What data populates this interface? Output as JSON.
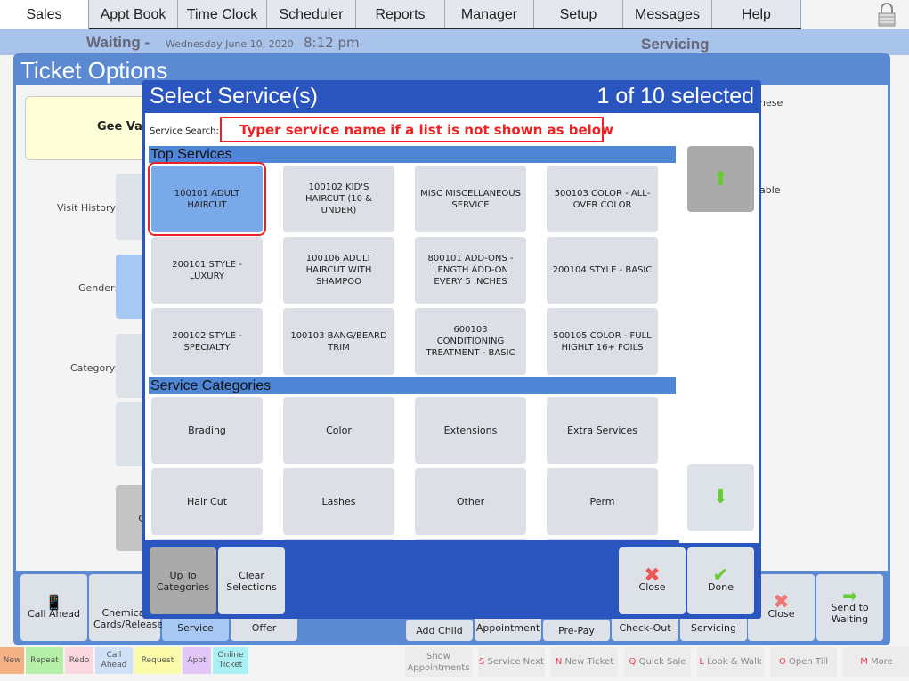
{
  "nav": {
    "tabs": [
      "Sales",
      "Appt Book",
      "Time Clock",
      "Scheduler",
      "Reports",
      "Manager",
      "Setup",
      "Messages",
      "Help"
    ],
    "active": "Sales"
  },
  "header": {
    "waiting": "Waiting -",
    "date": "Wednesday June 10, 2020",
    "time": "8:12 pm",
    "servicing": "Servicing"
  },
  "ticket": {
    "title": "Ticket Options",
    "client": "Gee Var",
    "visit_history": "Visit History:",
    "gender": "Gender:",
    "category": "Category:",
    "right_text_1": "nese",
    "right_text_2": "able",
    "partial_btn": "Cu"
  },
  "toolbar": {
    "call_ahead": "Call Ahead",
    "chemical": "Chemical Cards/Release",
    "service": "Service",
    "offer": "Offer",
    "add_child": "Add Child",
    "appointment": "Appointment",
    "prepay": "Pre-Pay",
    "checkout": "Check-Out",
    "servicing": "Servicing",
    "close": "Close",
    "send": "Send to Waiting"
  },
  "legend": [
    {
      "label": "New",
      "color": "#f4b183"
    },
    {
      "label": "Repeat",
      "color": "#b6f0a8"
    },
    {
      "label": "Redo",
      "color": "#fbd7e0"
    },
    {
      "label": "Call Ahead",
      "color": "#cfe0f7"
    },
    {
      "label": "Request",
      "color": "#fbfbaa"
    },
    {
      "label": "Appt",
      "color": "#e1c6f7"
    },
    {
      "label": "Online Ticket",
      "color": "#a8f0f4"
    }
  ],
  "bottom": [
    {
      "key": "",
      "label": "Show Appointments"
    },
    {
      "key": "S",
      "label": "Service Next"
    },
    {
      "key": "N",
      "label": "New Ticket"
    },
    {
      "key": "Q",
      "label": "Quick Sale"
    },
    {
      "key": "L",
      "label": "Look & Walk"
    },
    {
      "key": "O",
      "label": "Open Till"
    },
    {
      "key": "M",
      "label": "More"
    }
  ],
  "modal": {
    "title": "Select Service(s)",
    "count": "1 of 10 selected",
    "search_label": "Service Search:",
    "search_placeholder": "Typer service name if a list is not shown as below",
    "top_header": "Top Services",
    "cat_header": "Service Categories",
    "top_services": [
      "100101 ADULT HAIRCUT",
      "100102 KID'S HAIRCUT (10 & UNDER)",
      "MISC MISCELLANEOUS SERVICE",
      "500103 COLOR - ALL-OVER COLOR",
      "200101 STYLE - LUXURY",
      "100106 ADULT HAIRCUT WITH SHAMPOO",
      "800101 ADD-ONS - LENGTH ADD-ON EVERY 5 INCHES",
      "200104 STYLE - BASIC",
      "200102 STYLE - SPECIALTY",
      "100103 BANG/BEARD TRIM",
      "600103 CONDITIONING TREATMENT - BASIC",
      "500105 COLOR - FULL HIGHLT 16+ FOILS"
    ],
    "selected_index": 0,
    "categories": [
      "Brading",
      "Color",
      "Extensions",
      "Extra Services",
      "Hair Cut",
      "Lashes",
      "Other",
      "Perm"
    ],
    "up_to": "Up To Categories",
    "clear": "Clear Selections",
    "close": "Close",
    "done": "Done"
  },
  "colors": {
    "modal_blue": "#2a55be",
    "accent_selected": "#7aa9ea",
    "header": "#a9c4ea"
  }
}
